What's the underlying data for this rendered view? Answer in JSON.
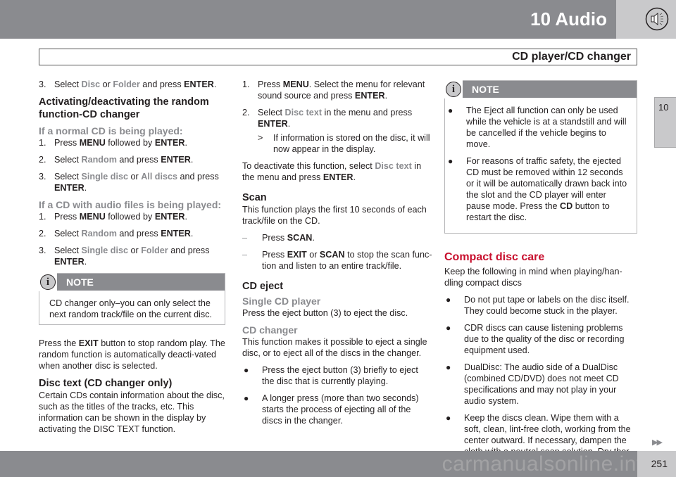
{
  "header": {
    "chapter": "10 Audio",
    "section": "CD player/CD changer",
    "icon": "speaker-icon"
  },
  "side_tab": {
    "label": "10"
  },
  "footer": {
    "page_number": "251",
    "watermark": "carmanualsonline.info",
    "continue_icon": "double-arrow-right-icon",
    "continue_glyph": "▶▶"
  },
  "col1": {
    "step3_top": {
      "num": "3.",
      "pre": "Select ",
      "a": "Disc",
      "mid": " or ",
      "b": "Folder",
      "post": " and press ",
      "key": "ENTER",
      "end": "."
    },
    "random_heading": "Activating/deactivating the random function-CD changer",
    "normal_cd_heading": "If a normal CD is being played:",
    "normal_steps": [
      {
        "num": "1.",
        "pre": "Press ",
        "k1": "MENU",
        "mid": " followed by ",
        "k2": "ENTER",
        "end": "."
      },
      {
        "num": "2.",
        "pre": "Select ",
        "hl": "Random",
        "mid": " and press ",
        "k2": "ENTER",
        "end": "."
      },
      {
        "num": "3.",
        "pre": "Select ",
        "hl1": "Single disc",
        "mid": " or ",
        "hl2": "All discs",
        "post": " and press ",
        "k2": "ENTER",
        "end": "."
      }
    ],
    "audio_files_heading": "If a CD with audio files is being played:",
    "audio_steps": [
      {
        "num": "1.",
        "pre": "Press ",
        "k1": "MENU",
        "mid": " followed by ",
        "k2": "ENTER",
        "end": "."
      },
      {
        "num": "2.",
        "pre": "Select ",
        "hl": "Random",
        "mid": " and press ",
        "k2": "ENTER",
        "end": "."
      },
      {
        "num": "3.",
        "pre": "Select ",
        "hl1": "Single disc",
        "mid": " or ",
        "hl2": "Folder",
        "post": " and press ",
        "k2": "ENTER",
        "end": "."
      }
    ],
    "note": {
      "label": "NOTE",
      "text": "CD changer only–you can only select the next random track/file on the current disc."
    },
    "exit_para": {
      "pre": "Press the ",
      "key": "EXIT",
      "post": " button to stop random play. The random function is automatically deacti-vated when another disc is selected."
    },
    "disc_text_heading": "Disc text (CD changer only)",
    "disc_text_para": "Certain CDs contain information about the disc, such as the titles of the tracks, etc. This information can be shown in the display by activating the DISC TEXT function."
  },
  "col2": {
    "step1": {
      "num": "1.",
      "pre": "Press ",
      "k1": "MENU",
      "mid": ". Select the menu for relevant sound source and press ",
      "k2": "ENTER",
      "end": "."
    },
    "step2": {
      "num": "2.",
      "pre": "Select ",
      "hl": "Disc text",
      "mid": " in the menu and press ",
      "k2": "ENTER",
      "end": "."
    },
    "step2_result": {
      "mark": ">",
      "text": "If information is stored on the disc, it will now appear in the display."
    },
    "deactivate": {
      "pre": "To deactivate this function, select ",
      "hl": "Disc text",
      "mid": " in the menu and press ",
      "key": "ENTER",
      "end": "."
    },
    "scan_heading": "Scan",
    "scan_para": "This function plays the first 10 seconds of each track/file on the CD.",
    "scan_items": [
      {
        "mark": "–",
        "pre": "Press ",
        "k1": "SCAN",
        "end": "."
      },
      {
        "mark": "–",
        "pre": "Press ",
        "k1": "EXIT",
        "mid": " or ",
        "k2": "SCAN",
        "end": " to stop the scan func-tion and listen to an entire track/file."
      }
    ],
    "eject_heading": "CD eject",
    "single_heading": "Single CD player",
    "single_para": "Press the eject button (3) to eject the disc.",
    "changer_heading": "CD changer",
    "changer_para": "This function makes it possible to eject a single disc, or to eject all of the discs in the changer.",
    "changer_bullets": [
      "Press the eject button (3) briefly to eject the disc that is currently playing.",
      "A longer press (more than two seconds) starts the process of ejecting all of the discs in the changer."
    ]
  },
  "col3": {
    "note": {
      "label": "NOTE",
      "bullet1": "The Eject all function can only be used while the vehicle is at a standstill and will be cancelled if the vehicle begins to move.",
      "bullet2_pre": "For reasons of traffic safety, the ejected CD must be removed within 12 seconds or it will be automatically drawn back into the slot and the CD player will enter pause mode. Press the ",
      "bullet2_key": "CD",
      "bullet2_post": " button to restart the disc."
    },
    "care_heading": "Compact disc care",
    "care_intro": "Keep the following in mind when playing/han-dling compact discs",
    "care_bullets": [
      "Do not put tape or labels on the disc itself. They could become stuck in the player.",
      "CDR discs can cause listening problems due to the quality of the disc or recording equipment used.",
      "DualDisc: The audio side of a DualDisc (combined CD/DVD) does not meet CD specifications and may not play in your audio system.",
      "Keep the discs clean. Wipe them with a soft, clean, lint-free cloth, working from the center outward. If necessary, dampen the cloth with a neutral soap solution. Dry thor-oughly before using."
    ]
  },
  "colors": {
    "accent_red": "#c8102e",
    "highlight_gray": "#8a8b8f",
    "bar_gray": "#8a8b8f",
    "tab_gray": "#c9c9cb"
  }
}
